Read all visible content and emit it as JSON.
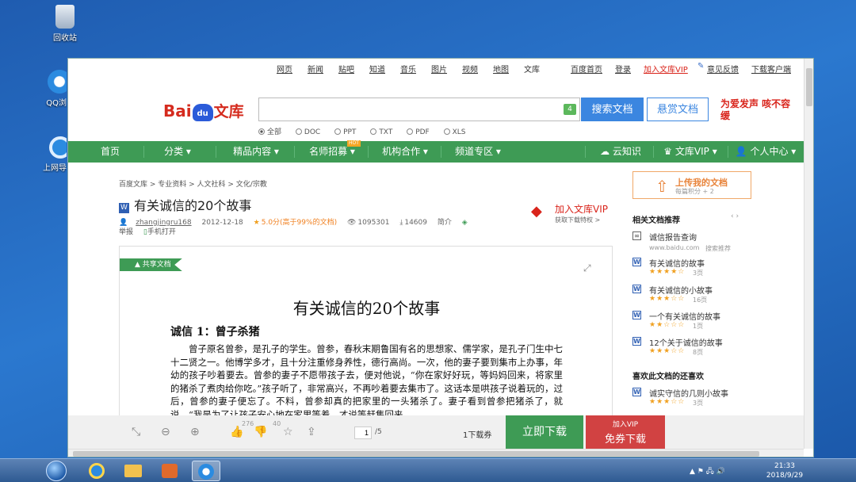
{
  "desktop": {
    "recycle_bin": "回收站",
    "qq_browser": "QQ浏",
    "net": "上网导"
  },
  "topnav": {
    "items": [
      "网页",
      "新闻",
      "贴吧",
      "知道",
      "音乐",
      "图片",
      "视频",
      "地图",
      "文库"
    ],
    "home": "百度首页",
    "login": "登录",
    "join_vip": "加入文库VIP",
    "feedback": "意见反馈",
    "client": "下载客户端"
  },
  "logo": {
    "bai": "Bai",
    "du": "du",
    "wenku": "文库"
  },
  "search": {
    "count": "4",
    "button": "搜索文档",
    "bounty": "悬赏文档",
    "slogan": "为爱发声 咳不容缓"
  },
  "filetypes": [
    "全部",
    "DOC",
    "PPT",
    "TXT",
    "PDF",
    "XLS"
  ],
  "greennav": {
    "home": "首页",
    "category": "分类",
    "premium": "精品内容",
    "teacher": "名师招募",
    "hot": "HOT",
    "partner": "机构合作",
    "channel": "频道专区",
    "cloud": "云知识",
    "vip": "文库VIP",
    "user": "个人中心"
  },
  "breadcrumb": "百度文库 > 专业资料 > 人文社科 > 文化/宗教",
  "doc": {
    "title": "有关诚信的20个故事",
    "author": "zhangjingru168",
    "date": "2012-12-18",
    "score": "5.0分(高于99%的文档)",
    "views": "1095301",
    "downloads": "14609",
    "intro": "简介",
    "report": "举报",
    "mobile": "手机打开"
  },
  "vip_join": {
    "title": "加入文库VIP",
    "sub": "获取下载特权 >"
  },
  "viewer": {
    "shared": "共享文档",
    "heading": "有关诚信的20个故事",
    "story_title": "诚信 1：曾子杀猪",
    "story_body": "曾子原名曾参，是孔子的学生。曾参，春秋末期鲁国有名的思想家、儒学家，是孔子门生中七十二贤之一。他博学多才，且十分注重修身养性，德行高尚。一次，他的妻子要到集市上办事，年幼的孩子吵着要去。曾参的妻子不愿带孩子去，便对他说，“你在家好好玩，等妈妈回来，将家里的猪杀了煮肉给你吃。”孩子听了，非常高兴，不再吵着要去集市了。这话本是哄孩子说着玩的，过后，曾参的妻子便忘了。不料，曾参却真的把家里的一头猪杀了。妻子看到曾参把猪杀了，就说，“我是为了让孩子安心地在家里等着，才说等赶集回来"
  },
  "sidebar": {
    "upload": "上传我的文档",
    "upload_sub": "每篇积分 + 2",
    "related": "相关文档推荐",
    "ad_title": "诚信报告查询",
    "ad_src": "www.baidu.com",
    "ad_tag": "搜索推荐",
    "items": [
      {
        "title": "有关诚信的故事",
        "stars": "★★★★☆",
        "pages": "3页"
      },
      {
        "title": "有关诚信的小故事",
        "stars": "★★★☆☆",
        "pages": "16页"
      },
      {
        "title": "一个有关诚信的故事",
        "stars": "★★☆☆☆",
        "pages": "1页"
      },
      {
        "title": "12个关于诚信的故事",
        "stars": "★★★☆☆",
        "pages": "8页"
      }
    ],
    "also": "喜欢此文档的还喜欢",
    "also_items": [
      {
        "title": "诚实守信的几则小故事",
        "stars": "★★★☆☆",
        "pages": "3页"
      }
    ]
  },
  "bottombar": {
    "likes": "276",
    "dislikes": "40",
    "page": "1",
    "total": "/5",
    "coupon": "1下载券",
    "download": "立即下载",
    "vip_top": "加入VIP",
    "vip_bottom": "免券下载"
  },
  "clock": {
    "time": "21:33",
    "date": "2018/9/29"
  }
}
